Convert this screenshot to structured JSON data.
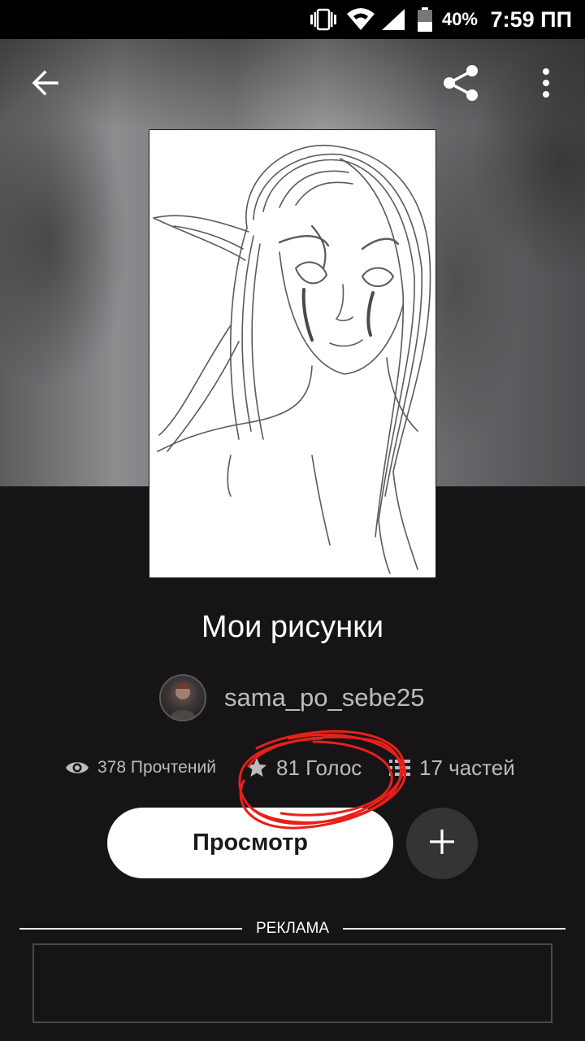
{
  "status_bar": {
    "battery": "40%",
    "time": "7:59 ПП",
    "icons": [
      "vibrate-icon",
      "wifi-icon",
      "cell-signal-icon",
      "battery-icon"
    ]
  },
  "toolbar": {
    "back_icon": "arrow-left-icon",
    "share_icon": "share-icon",
    "more_icon": "more-vertical-icon"
  },
  "story": {
    "title": "Мои рисунки",
    "author": "sama_po_sebe25",
    "stats": {
      "reads": "378 Прочтений",
      "votes": "81 Голос",
      "parts": "17 частей"
    },
    "read_button": "Просмотр"
  },
  "ad": {
    "label": "РЕКЛАМА"
  },
  "colors": {
    "background": "#161416",
    "button_bg": "#ffffff",
    "add_button_bg": "#353335",
    "stat_text": "#bdbbbd",
    "annotation": "#e8201a"
  }
}
